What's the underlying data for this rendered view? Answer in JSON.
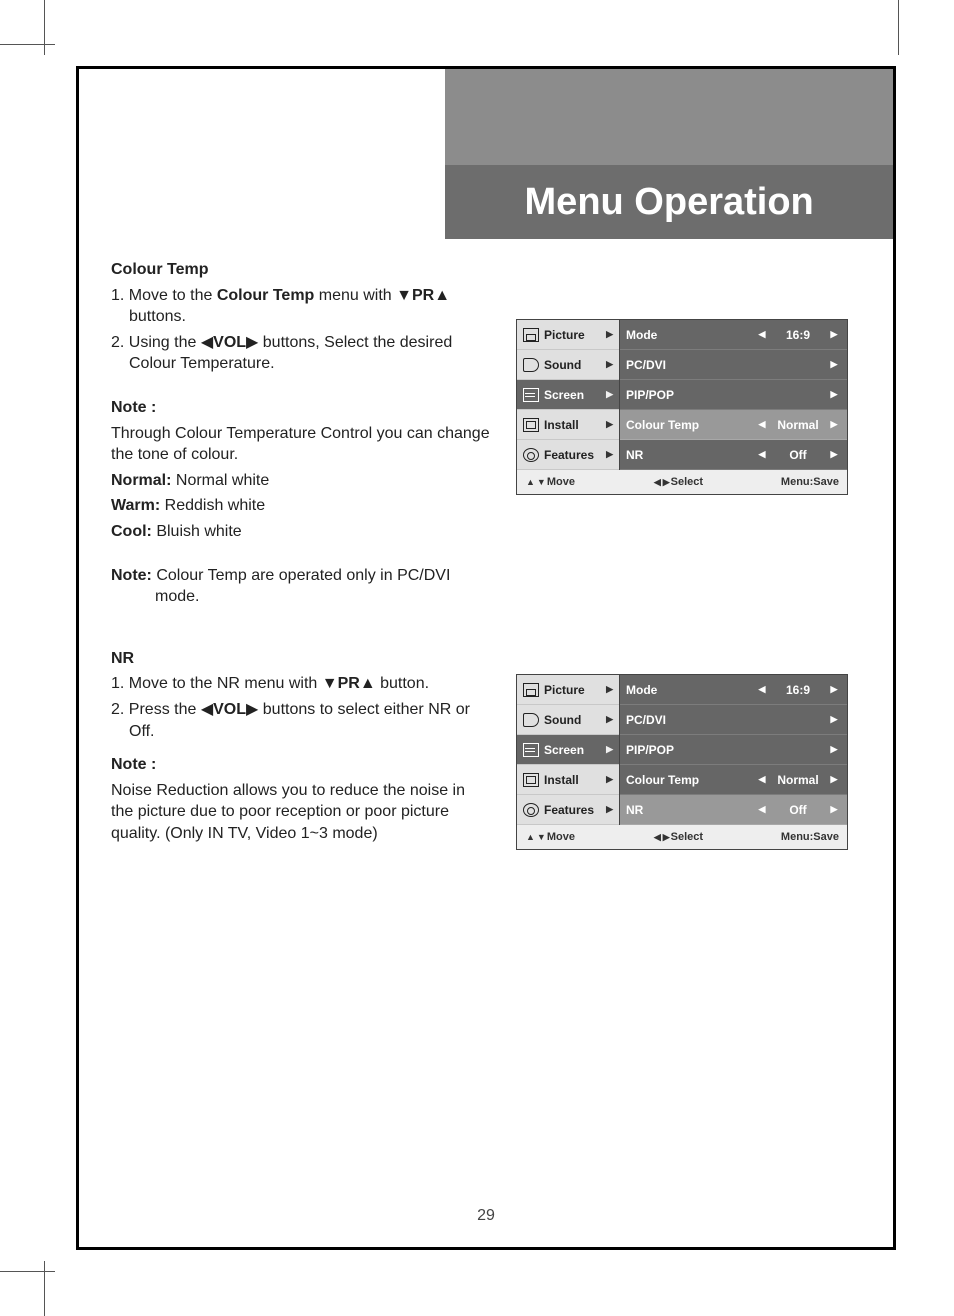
{
  "page": {
    "title": "Menu Operation",
    "number": "29"
  },
  "sections": {
    "colourTemp": {
      "heading": "Colour Temp",
      "step1_a": "1. Move to the ",
      "step1_b": "Colour Temp",
      "step1_c": " menu with ▼",
      "step1_d": "PR",
      "step1_e": "▲ buttons.",
      "step2_a": "2. Using the ◀",
      "step2_b": "VOL",
      "step2_c": "▶ buttons, Select the desired Colour Temperature.",
      "noteHead": "Note :",
      "noteBody": "Through Colour Temperature Control you can change the tone of colour.",
      "normal_k": "Normal:",
      "normal_v": " Normal white",
      "warm_k": "Warm:",
      "warm_v": " Reddish white",
      "cool_k": "Cool:",
      "cool_v": " Bluish white",
      "note2_k": "Note:",
      "note2_v": " Colour Temp are operated only in PC/DVI mode."
    },
    "nr": {
      "heading": "NR",
      "step1_a": "1. Move to the NR menu with ▼",
      "step1_b": "PR",
      "step1_c": "▲ button.",
      "step2_a": "2. Press the ◀",
      "step2_b": "VOL",
      "step2_c": "▶ buttons to select either NR or Off.",
      "noteHead": "Note :",
      "noteBody": "Noise Reduction allows you to reduce the noise in the picture due to poor reception or poor picture quality. (Only IN TV, Video 1~3 mode)"
    }
  },
  "osd": {
    "left": {
      "picture": "Picture",
      "sound": "Sound",
      "screen": "Screen",
      "install": "Install",
      "features": "Features"
    },
    "right": {
      "mode": {
        "name": "Mode",
        "value": "16:9",
        "hasLR": true
      },
      "pcdvi": {
        "name": "PC/DVI",
        "value": "",
        "hasR": true
      },
      "pippop": {
        "name": "PIP/POP",
        "value": "",
        "hasR": true
      },
      "colourtemp": {
        "name": "Colour Temp",
        "value": "Normal",
        "hasLR": true
      },
      "nr": {
        "name": "NR",
        "value": "Off",
        "hasLR": true
      }
    },
    "foot": {
      "move": "Move",
      "select": "Select",
      "menu": "Menu:Save"
    }
  }
}
